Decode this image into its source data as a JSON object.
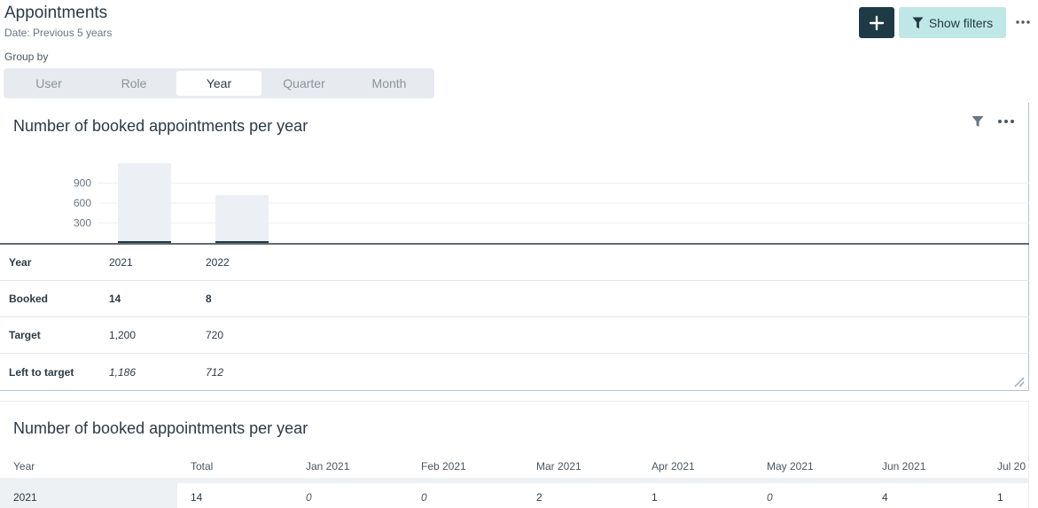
{
  "header": {
    "title": "Appointments",
    "subtitle": "Date: Previous 5 years",
    "show_filters_label": "Show filters"
  },
  "group_by": {
    "label": "Group by",
    "options": [
      "User",
      "Role",
      "Year",
      "Quarter",
      "Month"
    ],
    "selected": "Year"
  },
  "card1": {
    "title": "Number of booked appointments per year",
    "chart_data": {
      "type": "bar",
      "categories": [
        "2021",
        "2022"
      ],
      "series": [
        {
          "name": "Booked",
          "values": [
            14,
            8
          ],
          "color": "#1e3a44"
        },
        {
          "name": "Target",
          "values": [
            1200,
            720
          ],
          "color": "#eceff3"
        }
      ],
      "yticks": [
        "300",
        "600",
        "900"
      ],
      "ylim": [
        0,
        1200
      ],
      "grid": true
    },
    "table": {
      "rows": [
        {
          "label": "Year",
          "values": [
            "2021",
            "2022"
          ],
          "style": "plain"
        },
        {
          "label": "Booked",
          "values": [
            "14",
            "8"
          ],
          "style": "bold"
        },
        {
          "label": "Target",
          "values": [
            "1,200",
            "720"
          ],
          "style": "plain"
        },
        {
          "label": "Left to target",
          "values": [
            "1,186",
            "712"
          ],
          "style": "italic"
        }
      ]
    }
  },
  "card2": {
    "title": "Number of booked appointments per year",
    "columns": [
      "Year",
      "Total",
      "Jan 2021",
      "Feb 2021",
      "Mar 2021",
      "Apr 2021",
      "May 2021",
      "Jun 2021",
      "Jul 20"
    ],
    "rows": [
      {
        "cells": [
          "2021",
          "14",
          "0",
          "0",
          "2",
          "1",
          "0",
          "4",
          "1"
        ],
        "italic": [
          false,
          false,
          true,
          true,
          false,
          false,
          true,
          false,
          false
        ]
      }
    ]
  }
}
